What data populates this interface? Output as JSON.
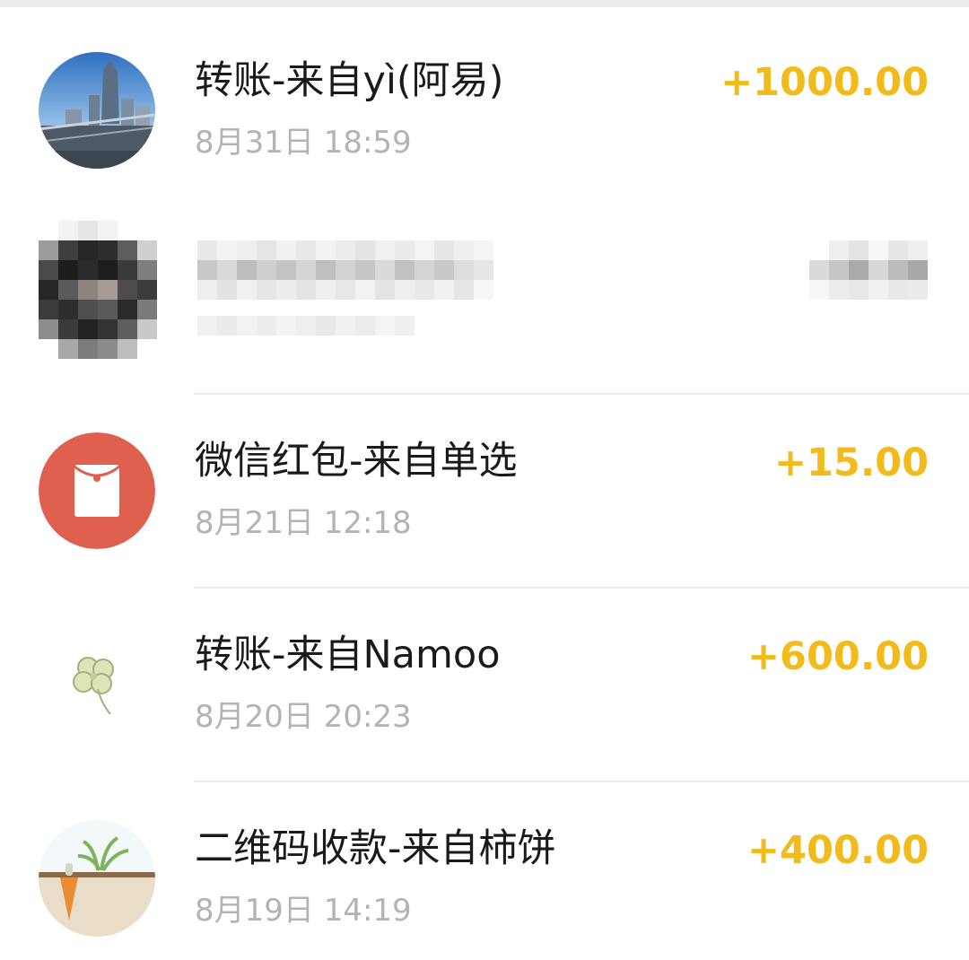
{
  "transactions": [
    {
      "title": "转账-来自yì(阿易)",
      "time": "8月31日 18:59",
      "amount": "+1000.00",
      "avatar_icon": "city-skyline-avatar"
    },
    {
      "title": "",
      "time": "",
      "amount": "",
      "avatar_icon": "pixelated-avatar"
    },
    {
      "title": "微信红包-来自单选",
      "time": "8月21日 12:18",
      "amount": "+15.00",
      "avatar_icon": "red-envelope-icon"
    },
    {
      "title": "转账-来自Namoo",
      "time": "8月20日 20:23",
      "amount": "+600.00",
      "avatar_icon": "clover-avatar"
    },
    {
      "title": "二维码收款-来自柿饼",
      "time": "8月19日 14:19",
      "amount": "+400.00",
      "avatar_icon": "carrot-avatar"
    }
  ],
  "colors": {
    "amount": "#f1bb1b",
    "title": "#1a1a1a",
    "time": "#b3b3b3",
    "red_envelope_bg": "#e0604f",
    "divider": "#ececec"
  }
}
